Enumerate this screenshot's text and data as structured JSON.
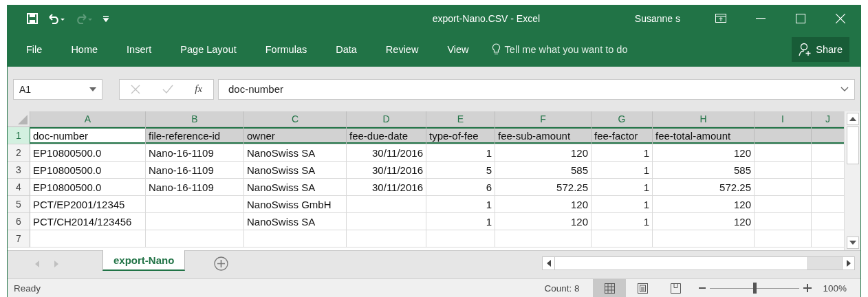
{
  "window": {
    "title": "export-Nano.CSV  -  Excel",
    "user": "Susanne s"
  },
  "quick_access": [
    {
      "kind": "save",
      "disabled": false
    },
    {
      "kind": "undo",
      "disabled": false
    },
    {
      "kind": "redo",
      "disabled": true
    }
  ],
  "ribbon_tabs": [
    "File",
    "Home",
    "Insert",
    "Page Layout",
    "Formulas",
    "Data",
    "Review",
    "View"
  ],
  "tell_me": {
    "placeholder": "Tell me what you want to do"
  },
  "share_button": "Share",
  "formula_bar": {
    "name_box": "A1",
    "cancel_disabled": true,
    "enter_disabled": true,
    "function_label": "fx",
    "value": "doc-number"
  },
  "columns": [
    {
      "label": "A",
      "selected": true
    },
    {
      "label": "B",
      "selected": true
    },
    {
      "label": "C",
      "selected": true
    },
    {
      "label": "D",
      "selected": true
    },
    {
      "label": "E",
      "selected": true
    },
    {
      "label": "F",
      "selected": true
    },
    {
      "label": "G",
      "selected": true
    },
    {
      "label": "H",
      "selected": true
    },
    {
      "label": "I",
      "selected": true
    },
    {
      "label": "J",
      "selected": true
    }
  ],
  "rows": [
    {
      "number": "1",
      "selected": true,
      "cells": [
        {
          "value": "doc-number",
          "numeric": false
        },
        {
          "value": "file-reference-id",
          "numeric": false
        },
        {
          "value": "owner",
          "numeric": false
        },
        {
          "value": "fee-due-date",
          "numeric": false
        },
        {
          "value": "type-of-fee",
          "numeric": false
        },
        {
          "value": "fee-sub-amount",
          "numeric": false
        },
        {
          "value": "fee-factor",
          "numeric": false
        },
        {
          "value": "fee-total-amount",
          "numeric": false
        },
        null,
        null
      ]
    },
    {
      "number": "2",
      "selected": false,
      "cells": [
        {
          "value": "EP10800500.0",
          "numeric": false
        },
        {
          "value": "Nano-16-1109",
          "numeric": false
        },
        {
          "value": "NanoSwiss SA",
          "numeric": false
        },
        {
          "value": "30/11/2016",
          "numeric": true
        },
        {
          "value": "1",
          "numeric": true
        },
        {
          "value": "120",
          "numeric": true
        },
        {
          "value": "1",
          "numeric": true
        },
        {
          "value": "120",
          "numeric": true
        },
        null,
        null
      ]
    },
    {
      "number": "3",
      "selected": false,
      "cells": [
        {
          "value": "EP10800500.0",
          "numeric": false
        },
        {
          "value": "Nano-16-1109",
          "numeric": false
        },
        {
          "value": "NanoSwiss SA",
          "numeric": false
        },
        {
          "value": "30/11/2016",
          "numeric": true
        },
        {
          "value": "5",
          "numeric": true
        },
        {
          "value": "585",
          "numeric": true
        },
        {
          "value": "1",
          "numeric": true
        },
        {
          "value": "585",
          "numeric": true
        },
        null,
        null
      ]
    },
    {
      "number": "4",
      "selected": false,
      "cells": [
        {
          "value": "EP10800500.0",
          "numeric": false
        },
        {
          "value": "Nano-16-1109",
          "numeric": false
        },
        {
          "value": "NanoSwiss SA",
          "numeric": false
        },
        {
          "value": "30/11/2016",
          "numeric": true
        },
        {
          "value": "6",
          "numeric": true
        },
        {
          "value": "572.25",
          "numeric": true
        },
        {
          "value": "1",
          "numeric": true
        },
        {
          "value": "572.25",
          "numeric": true
        },
        null,
        null
      ]
    },
    {
      "number": "5",
      "selected": false,
      "cells": [
        {
          "value": "PCT/EP2001/12345",
          "numeric": false
        },
        null,
        {
          "value": "NanoSwiss GmbH",
          "numeric": false
        },
        null,
        {
          "value": "1",
          "numeric": true
        },
        {
          "value": "120",
          "numeric": true
        },
        {
          "value": "1",
          "numeric": true
        },
        {
          "value": "120",
          "numeric": true
        },
        null,
        null
      ]
    },
    {
      "number": "6",
      "selected": false,
      "cells": [
        {
          "value": "PCT/CH2014/123456",
          "numeric": false
        },
        null,
        {
          "value": "NanoSwiss SA",
          "numeric": false
        },
        null,
        {
          "value": "1",
          "numeric": true
        },
        {
          "value": "120",
          "numeric": true
        },
        {
          "value": "1",
          "numeric": true
        },
        {
          "value": "120",
          "numeric": true
        },
        null,
        null
      ]
    },
    {
      "number": "7",
      "selected": false,
      "cells": [
        null,
        null,
        null,
        null,
        null,
        null,
        null,
        null,
        null,
        null
      ]
    }
  ],
  "sheets": [
    {
      "name": "export-Nano",
      "selected": true
    }
  ],
  "status_bar": {
    "mode": "Ready",
    "count": "Count: 8",
    "views": [
      {
        "kind": "normal",
        "selected": true
      },
      {
        "kind": "page-layout",
        "selected": false
      },
      {
        "kind": "page-break",
        "selected": false
      }
    ],
    "zoom": {
      "level": 0.5,
      "reading": "100%"
    }
  }
}
